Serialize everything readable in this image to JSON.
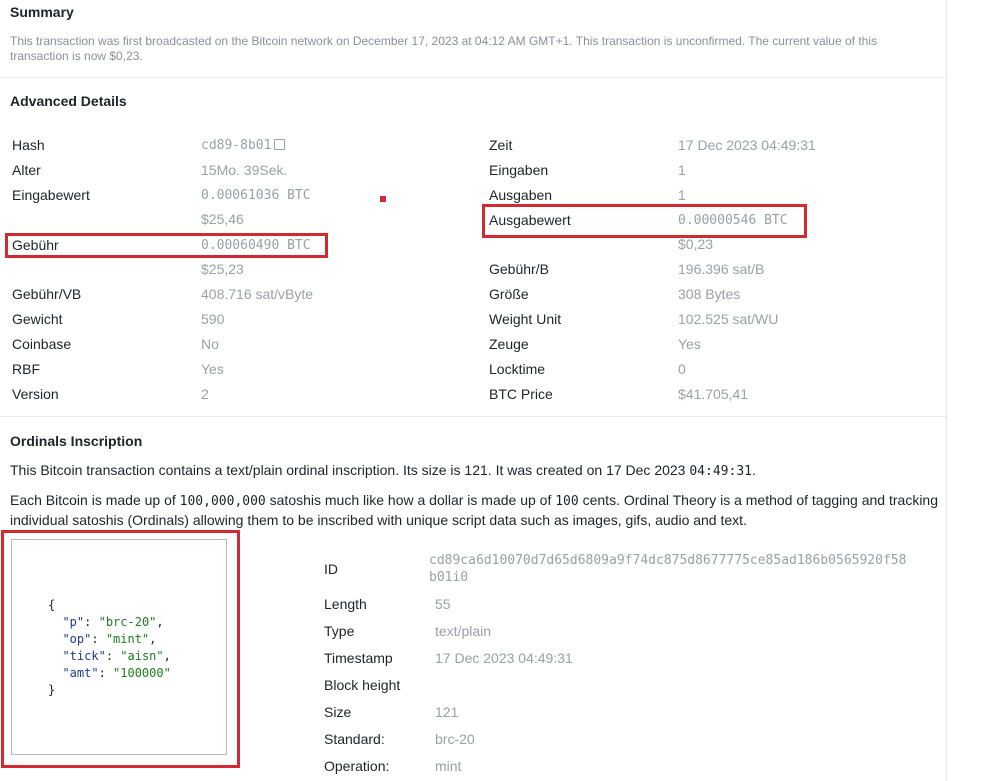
{
  "summary": {
    "title": "Summary",
    "text": "This transaction was first broadcasted on the Bitcoin network on December 17, 2023 at 04:12 AM GMT+1. This transaction is unconfirmed. The current value of this transaction is now $0,23."
  },
  "advanced": {
    "title": "Advanced Details",
    "left": {
      "hash_label": "Hash",
      "hash_value": "cd89-8b01",
      "alter_label": "Alter",
      "alter_value": "15Mo. 39Sek.",
      "eingabewert_label": "Eingabewert",
      "eingabewert_btc": "0.00061036 BTC",
      "eingabewert_usd": "$25,46",
      "gebuehr_label": "Gebühr",
      "gebuehr_btc": "0.00060490 BTC",
      "gebuehr_usd": "$25,23",
      "gebuehr_vb_label": "Gebühr/VB",
      "gebuehr_vb_value": "408.716 sat/vByte",
      "gewicht_label": "Gewicht",
      "gewicht_value": "590",
      "coinbase_label": "Coinbase",
      "coinbase_value": "No",
      "rbf_label": "RBF",
      "rbf_value": "Yes",
      "version_label": "Version",
      "version_value": "2"
    },
    "right": {
      "zeit_label": "Zeit",
      "zeit_value": "17 Dec 2023 04:49:31",
      "eingaben_label": "Eingaben",
      "eingaben_value": "1",
      "ausgaben_label": "Ausgaben",
      "ausgaben_value": "1",
      "ausgabewert_label": "Ausgabewert",
      "ausgabewert_btc": "0.00000546 BTC",
      "ausgabewert_usd": "$0,23",
      "gebuehr_b_label": "Gebühr/B",
      "gebuehr_b_value": "196.396 sat/B",
      "groesse_label": "Größe",
      "groesse_value": "308 Bytes",
      "weight_unit_label": "Weight Unit",
      "weight_unit_value": "102.525 sat/WU",
      "zeuge_label": "Zeuge",
      "zeuge_value": "Yes",
      "locktime_label": "Locktime",
      "locktime_value": "0",
      "btc_price_label": "BTC Price",
      "btc_price_value": "$41.705,41"
    }
  },
  "ordinals": {
    "title": "Ordinals Inscription",
    "intro_prefix": "This Bitcoin transaction contains a text/plain ordinal inscription. Its size is 121. It was created on 17 Dec 2023 ",
    "intro_time": "04:49:31",
    "intro_suffix": ".",
    "theory_p1": "Each Bitcoin is made up of ",
    "theory_num1": "100,000,000",
    "theory_p2": " satoshis much like how a dollar is made up of ",
    "theory_num2": "100",
    "theory_p3": " cents. Ordinal Theory is a method of tagging and tracking individual satoshis (Ordinals) allowing them to be inscribed with unique script data such as images, gifs, audio and text.",
    "code": {
      "open": "{",
      "p_key": "\"p\"",
      "p_val": "\"brc-20\"",
      "op_key": "\"op\"",
      "op_val": "\"mint\"",
      "tick_key": "\"tick\"",
      "tick_val": "\"aisn\"",
      "amt_key": "\"amt\"",
      "amt_val": "\"100000\"",
      "close": "}"
    },
    "details": {
      "id_label": "ID",
      "id_line1": "cd89ca6d10070d7d65d6809a9f74dc875d8677775ce85ad186b0565920f58",
      "id_line2": "b01i0",
      "length_label": "Length",
      "length_value": "55",
      "type_label": "Type",
      "type_value": "text/plain",
      "timestamp_label": "Timestamp",
      "timestamp_value": "17 Dec 2023 04:49:31",
      "block_height_label": "Block height",
      "block_height_value": "",
      "size_label": "Size",
      "size_value": "121",
      "standard_label": "Standard:",
      "standard_value": "brc-20",
      "operation_label": "Operation:",
      "operation_value": "mint"
    }
  },
  "colors": {
    "highlight": "#d12a33",
    "muted": "#9aa0a6",
    "json_key": "#1f3a93",
    "json_string": "#1e7d1e"
  },
  "icons": {
    "copy": "copy-icon"
  }
}
